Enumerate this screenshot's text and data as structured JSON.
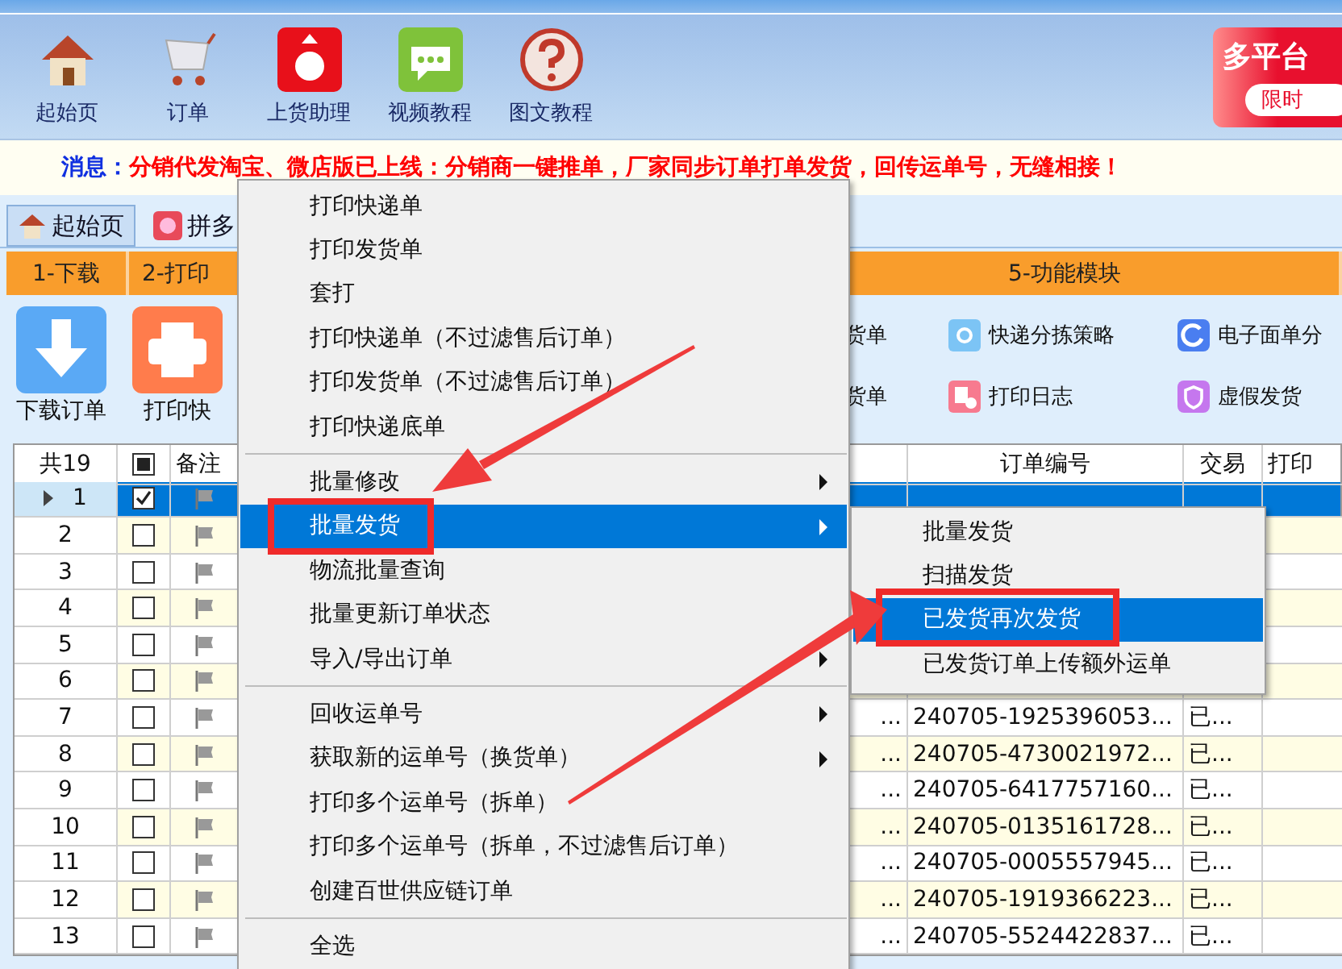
{
  "toolbar": {
    "buttons": [
      {
        "label": "起始页",
        "kind": "home"
      },
      {
        "label": "订单",
        "kind": "cart"
      },
      {
        "label": "上货助理",
        "kind": "bag"
      },
      {
        "label": "视频教程",
        "kind": "chat"
      },
      {
        "label": "图文教程",
        "kind": "help"
      }
    ]
  },
  "ad_banner": {
    "title": "多平台",
    "pill": "限时"
  },
  "message": {
    "label": "消息：",
    "text": "分销代发淘宝、微店版已上线：分销商一键推单，厂家同步订单打单发货，回传运单号，无缝相接！"
  },
  "tabs": [
    {
      "label": "起始页",
      "selected": true
    },
    {
      "label": "拼多",
      "selected": false
    }
  ],
  "steps": [
    {
      "label": "1-下载"
    },
    {
      "label": "2-打印"
    },
    {
      "label": "5-功能模块"
    }
  ],
  "big_buttons": [
    {
      "label": "下载订单",
      "kind": "download"
    },
    {
      "label": "打印快",
      "kind": "print"
    }
  ],
  "functions": [
    {
      "label": "货单",
      "kind": "hidden"
    },
    {
      "label": "快递分拣策略",
      "kind": "sort"
    },
    {
      "label": "电子面单分",
      "kind": "cycle"
    },
    {
      "label": "货单",
      "kind": "hidden"
    },
    {
      "label": "打印日志",
      "kind": "log"
    },
    {
      "label": "虚假发货",
      "kind": "shield"
    }
  ],
  "table": {
    "header": {
      "count": "共19",
      "select_all_indeterminate": true,
      "remark": "备注",
      "order": "订单编号",
      "trade": "交易",
      "print": "打印"
    },
    "rows": [
      {
        "no": "1",
        "checked": true,
        "selected": true
      },
      {
        "no": "2",
        "checked": false,
        "selected": false
      },
      {
        "no": "3",
        "checked": false,
        "selected": false
      },
      {
        "no": "4",
        "checked": false,
        "selected": false
      },
      {
        "no": "5",
        "checked": false,
        "selected": false
      },
      {
        "no": "6",
        "checked": false,
        "selected": false
      },
      {
        "no": "7",
        "checked": false,
        "selected": false,
        "column_4": "...",
        "order": "240705-1925396053...",
        "trade": "已..."
      },
      {
        "no": "8",
        "checked": false,
        "selected": false,
        "column_4": "...",
        "order": "240705-4730021972...",
        "trade": "已..."
      },
      {
        "no": "9",
        "checked": false,
        "selected": false,
        "column_4": "...",
        "order": "240705-6417757160...",
        "trade": "已..."
      },
      {
        "no": "10",
        "checked": false,
        "selected": false,
        "column_4": "...",
        "order": "240705-0135161728...",
        "trade": "已..."
      },
      {
        "no": "11",
        "checked": false,
        "selected": false,
        "column_4": "...",
        "order": "240705-0005557945...",
        "trade": "已..."
      },
      {
        "no": "12",
        "checked": false,
        "selected": false,
        "column_4": "...",
        "order": "240705-1919366223...",
        "trade": "已..."
      },
      {
        "no": "13",
        "checked": false,
        "selected": false,
        "column_4": "...",
        "order": "240705-5524422837...",
        "trade": "已..."
      }
    ]
  },
  "context_menu": {
    "groups": [
      [
        {
          "label": "打印快递单",
          "submenu": false,
          "selected": false
        },
        {
          "label": "打印发货单",
          "submenu": false,
          "selected": false
        },
        {
          "label": "套打",
          "submenu": false,
          "selected": false
        },
        {
          "label": "打印快递单（不过滤售后订单）",
          "submenu": false,
          "selected": false
        },
        {
          "label": "打印发货单（不过滤售后订单）",
          "submenu": false,
          "selected": false
        },
        {
          "label": "打印快递底单",
          "submenu": false,
          "selected": false
        }
      ],
      [
        {
          "label": "批量修改",
          "submenu": true,
          "selected": false
        },
        {
          "label": "批量发货",
          "submenu": true,
          "selected": true
        },
        {
          "label": "物流批量查询",
          "submenu": false,
          "selected": false
        },
        {
          "label": "批量更新订单状态",
          "submenu": false,
          "selected": false
        },
        {
          "label": "导入/导出订单",
          "submenu": true,
          "selected": false
        }
      ],
      [
        {
          "label": "回收运单号",
          "submenu": true,
          "selected": false
        },
        {
          "label": "获取新的运单号（换货单）",
          "submenu": true,
          "selected": false
        },
        {
          "label": "打印多个运单号（拆单）",
          "submenu": false,
          "selected": false
        },
        {
          "label": "打印多个运单号（拆单，不过滤售后订单）",
          "submenu": false,
          "selected": false
        },
        {
          "label": "创建百世供应链订单",
          "submenu": false,
          "selected": false
        }
      ],
      [
        {
          "label": "全选",
          "submenu": false,
          "selected": false
        }
      ]
    ]
  },
  "submenu": {
    "items": [
      {
        "label": "批量发货",
        "selected": false
      },
      {
        "label": "扫描发货",
        "selected": false
      },
      {
        "label": "已发货再次发货",
        "selected": true
      },
      {
        "label": "已发货订单上传额外运单",
        "selected": false
      }
    ]
  }
}
